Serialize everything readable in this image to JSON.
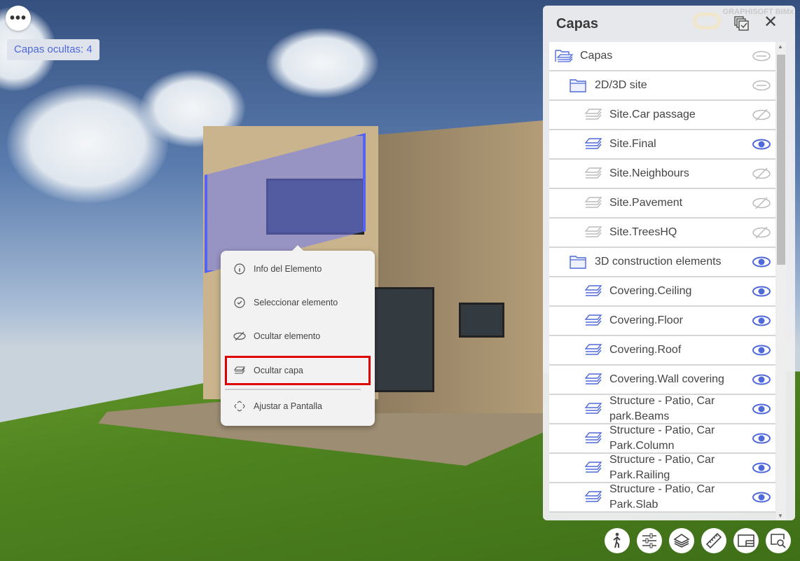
{
  "viewer": {
    "more_label": "•••",
    "hidden_layers_label": "Capas ocultas: 4"
  },
  "context_menu": {
    "items": [
      {
        "label": "Info del Elemento",
        "icon": "info-icon"
      },
      {
        "label": "Seleccionar elemento",
        "icon": "check-circle-icon"
      },
      {
        "label": "Ocultar elemento",
        "icon": "eye-off-icon"
      },
      {
        "label": "Ocultar capa",
        "icon": "layers-icon",
        "highlighted": true
      },
      {
        "label": "Ajustar a Pantalla",
        "icon": "fit-screen-icon"
      }
    ]
  },
  "panel": {
    "title": "Capas",
    "brand": "GRAPHISOFT BIMx",
    "rows": [
      {
        "label": "Capas",
        "level": 0,
        "type": "root",
        "visibility": "mixed"
      },
      {
        "label": "2D/3D site",
        "level": 1,
        "type": "folder",
        "visibility": "mixed"
      },
      {
        "label": "Site.Car passage",
        "level": 2,
        "type": "layer",
        "visibility": "hidden"
      },
      {
        "label": "Site.Final",
        "level": 2,
        "type": "layer",
        "visibility": "visible"
      },
      {
        "label": "Site.Neighbours",
        "level": 2,
        "type": "layer",
        "visibility": "hidden"
      },
      {
        "label": "Site.Pavement",
        "level": 2,
        "type": "layer",
        "visibility": "hidden"
      },
      {
        "label": "Site.TreesHQ",
        "level": 2,
        "type": "layer",
        "visibility": "hidden"
      },
      {
        "label": "3D construction elements",
        "level": 1,
        "type": "folder",
        "visibility": "visible"
      },
      {
        "label": "Covering.Ceiling",
        "level": 2,
        "type": "layer",
        "visibility": "visible"
      },
      {
        "label": "Covering.Floor",
        "level": 2,
        "type": "layer",
        "visibility": "visible"
      },
      {
        "label": "Covering.Roof",
        "level": 2,
        "type": "layer",
        "visibility": "visible"
      },
      {
        "label": "Covering.Wall covering",
        "level": 2,
        "type": "layer",
        "visibility": "visible"
      },
      {
        "label": "Structure - Patio, Car park.Beams",
        "level": 2,
        "type": "layer",
        "visibility": "visible"
      },
      {
        "label": "Structure - Patio, Car Park.Column",
        "level": 2,
        "type": "layer",
        "visibility": "visible"
      },
      {
        "label": "Structure - Patio, Car Park.Railing",
        "level": 2,
        "type": "layer",
        "visibility": "visible"
      },
      {
        "label": "Structure - Patio, Car Park.Slab",
        "level": 2,
        "type": "layer",
        "visibility": "visible"
      }
    ]
  },
  "toolbar": [
    {
      "icon": "walk-icon"
    },
    {
      "icon": "sliders-icon"
    },
    {
      "icon": "layers-icon"
    },
    {
      "icon": "ruler-icon"
    },
    {
      "icon": "sheet-icon"
    },
    {
      "icon": "zoom-area-icon"
    }
  ],
  "colors": {
    "accent": "#4f69d9",
    "highlight": "#e00000"
  }
}
